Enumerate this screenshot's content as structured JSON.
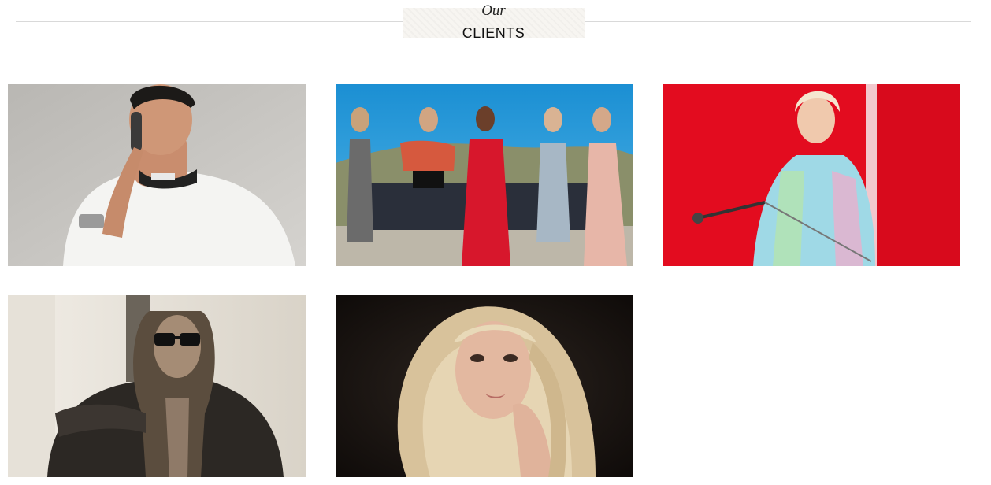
{
  "section": {
    "subtitle": "Our",
    "title": "CLIENTS"
  },
  "clients": [
    {
      "name": "client-photo-1",
      "description_visual": "dj-with-headphones"
    },
    {
      "name": "client-photo-2",
      "description_visual": "five-women-group"
    },
    {
      "name": "client-photo-3",
      "description_visual": "woman-red-background-microphone"
    },
    {
      "name": "client-photo-4",
      "description_visual": "man-sunglasses-sepia"
    },
    {
      "name": "client-photo-5",
      "description_visual": "blonde-woman-portrait"
    }
  ],
  "colors": {
    "divider": "#d9d9d9",
    "heading_bg": "#f7f5f1",
    "photo3_bg": "#e30c1f",
    "photo2_sky": "#1f9cd6"
  }
}
